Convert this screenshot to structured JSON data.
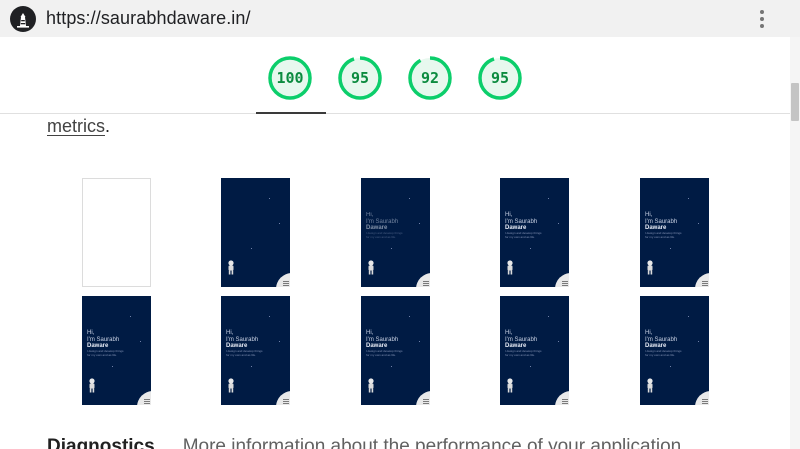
{
  "browser": {
    "url": "https://saurabhdaware.in/",
    "site_icon": "lighthouse-icon",
    "menu_icon": "kebab-menu-icon"
  },
  "scores": [
    {
      "value": 100,
      "color": "#0cce6b"
    },
    {
      "value": 95,
      "color": "#0cce6b"
    },
    {
      "value": 92,
      "color": "#0cce6b"
    },
    {
      "value": 95,
      "color": "#0cce6b"
    }
  ],
  "content": {
    "metrics_link": "metrics",
    "metrics_suffix": ".",
    "diagnostics_title": "Diagnostics",
    "diagnostics_desc": "More information about the performance of your application."
  },
  "frame_text": {
    "line1": "Hi,",
    "line2": "I'm Saurabh",
    "line3": "Daware",
    "tagline": "I design and develop things for my own and as life."
  },
  "filmstrip": [
    {
      "state": "blank"
    },
    {
      "state": "dark"
    },
    {
      "state": "text-dim"
    },
    {
      "state": "text"
    },
    {
      "state": "text"
    },
    {
      "state": "text"
    },
    {
      "state": "text"
    },
    {
      "state": "text"
    },
    {
      "state": "text"
    },
    {
      "state": "text"
    }
  ]
}
